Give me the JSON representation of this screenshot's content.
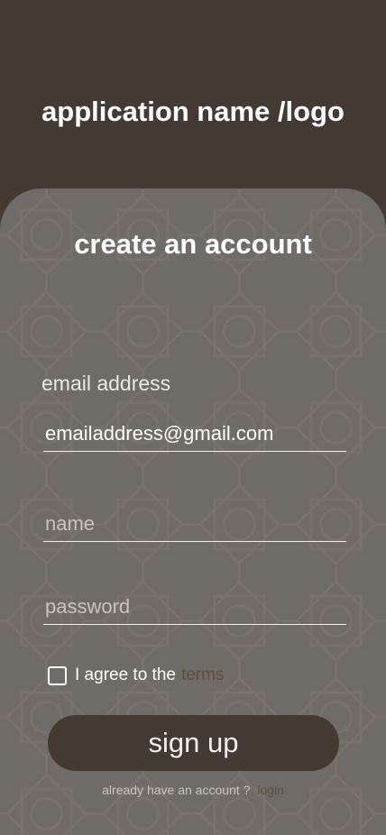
{
  "header": {
    "app_title": "application name /logo"
  },
  "form": {
    "title": "create an account",
    "email_label": "email address",
    "email_value": "emailaddress@gmail.com",
    "name_placeholder": "name",
    "password_placeholder": "password",
    "agree_text": "I agree to the",
    "terms_link": "terms",
    "signup_label": "sign up"
  },
  "footer": {
    "prompt": "already have an account ?",
    "login_link": "login"
  },
  "colors": {
    "background": "#433a34",
    "card": "#6f6b66",
    "link": "#5f4e43",
    "button": "#433a34"
  }
}
